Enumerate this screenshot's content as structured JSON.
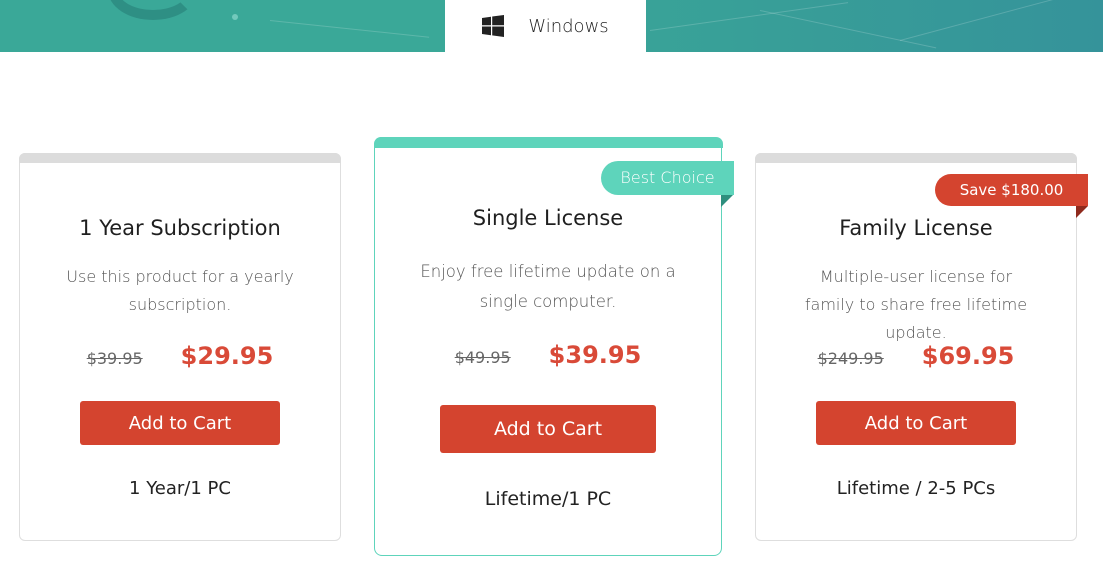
{
  "os_tab": {
    "label": "Windows",
    "icon": "windows-icon"
  },
  "colors": {
    "banner": "#3aa898",
    "accent": "#5ed4bb",
    "price": "#d94a38",
    "button": "#d4442f"
  },
  "plans": [
    {
      "title": "1 Year Subscription",
      "description": "Use this product for a yearly subscription.",
      "old_price": "$39.95",
      "new_price": "$29.95",
      "button": "Add to Cart",
      "footnote": "1 Year/1 PC"
    },
    {
      "title": "Single License",
      "description": "Enjoy free lifetime update on a single computer.",
      "old_price": "$49.95",
      "new_price": "$39.95",
      "button": "Add to Cart",
      "footnote": "Lifetime/1 PC",
      "ribbon": "Best Choice"
    },
    {
      "title": "Family License",
      "description": "Multiple-user license for family to share free lifetime update.",
      "old_price": "$249.95",
      "new_price": "$69.95",
      "button": "Add to Cart",
      "footnote": "Lifetime / 2-5 PCs",
      "ribbon": "Save $180.00"
    }
  ]
}
